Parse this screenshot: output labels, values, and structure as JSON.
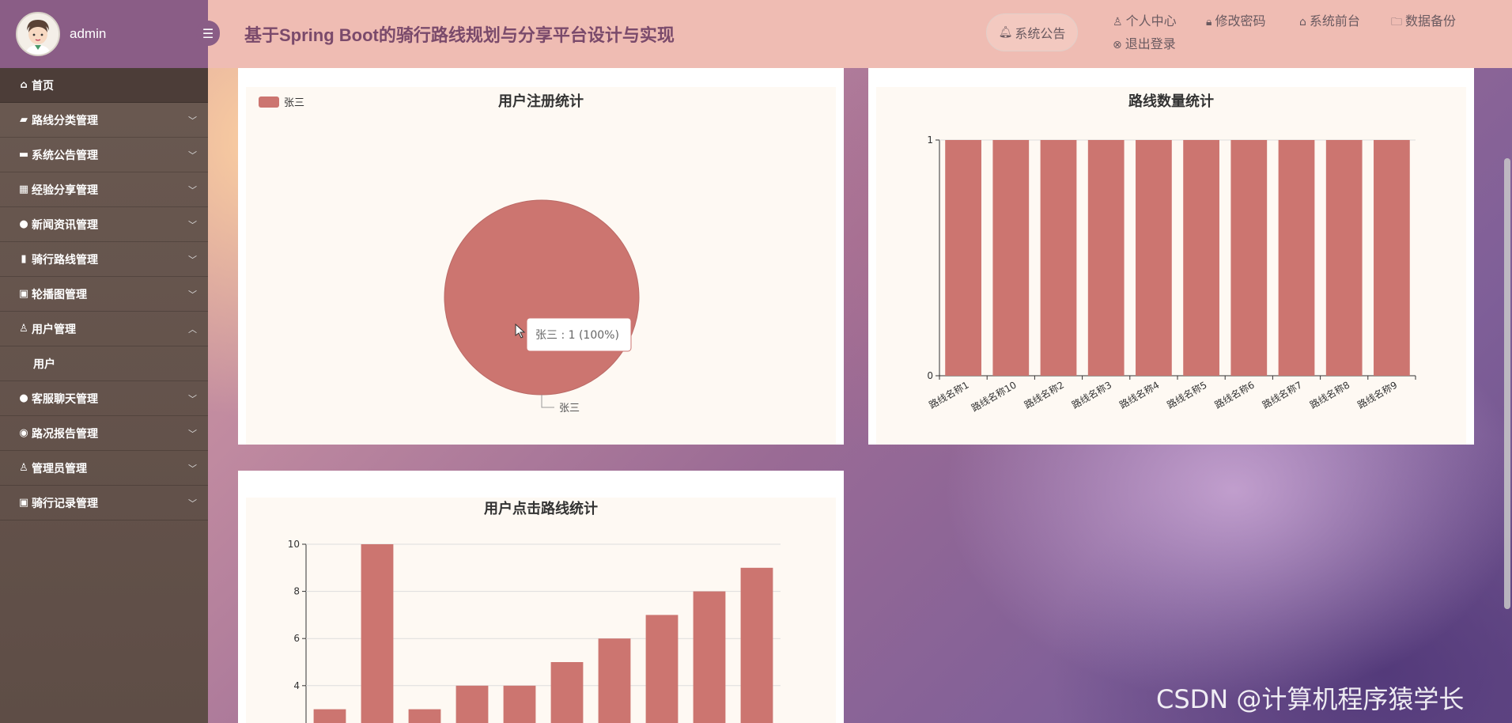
{
  "sidebar": {
    "user": "admin",
    "menu": [
      {
        "label": "首页",
        "icon": "home-icon",
        "chevron": ""
      },
      {
        "label": "路线分类管理",
        "icon": "folder-icon",
        "chevron": "﹀"
      },
      {
        "label": "系统公告管理",
        "icon": "folder-icon",
        "chevron": "﹀"
      },
      {
        "label": "经验分享管理",
        "icon": "grid-icon",
        "chevron": "﹀"
      },
      {
        "label": "新闻资讯管理",
        "icon": "drop-icon",
        "chevron": "﹀"
      },
      {
        "label": "骑行路线管理",
        "icon": "copy-icon",
        "chevron": "﹀"
      },
      {
        "label": "轮播图管理",
        "icon": "book-icon",
        "chevron": "﹀"
      },
      {
        "label": "用户管理",
        "icon": "user-icon",
        "chevron": "︿"
      },
      {
        "label": "客服聊天管理",
        "icon": "circle-icon",
        "chevron": "﹀"
      },
      {
        "label": "路况报告管理",
        "icon": "report-icon",
        "chevron": "﹀"
      },
      {
        "label": "管理员管理",
        "icon": "user-icon",
        "chevron": "﹀"
      },
      {
        "label": "骑行记录管理",
        "icon": "book-icon",
        "chevron": "﹀"
      }
    ],
    "submenu": "用户"
  },
  "header": {
    "title": "基于Spring Boot的骑行路线规划与分享平台设计与实现",
    "notice": "系统公告",
    "links": {
      "profile": "个人中心",
      "password": "修改密码",
      "frontend": "系统前台",
      "backup": "数据备份",
      "logout": "退出登录"
    }
  },
  "chart_data": [
    {
      "type": "pie",
      "title": "用户注册统计",
      "labels": [
        "张三"
      ],
      "values": [
        1
      ],
      "legend": "top-left",
      "tooltip": "张三 : 1 (100%)",
      "color": "#cc7570"
    },
    {
      "type": "bar",
      "title": "路线数量统计",
      "categories": [
        "路线名称1",
        "路线名称10",
        "路线名称2",
        "路线名称3",
        "路线名称4",
        "路线名称5",
        "路线名称6",
        "路线名称7",
        "路线名称8",
        "路线名称9"
      ],
      "values": [
        1,
        1,
        1,
        1,
        1,
        1,
        1,
        1,
        1,
        1
      ],
      "ylim": [
        0,
        1
      ],
      "yticks": [
        0,
        1
      ],
      "color": "#cc7570"
    },
    {
      "type": "bar",
      "title": "用户点击路线统计",
      "values": [
        3,
        10,
        3,
        4,
        4,
        5,
        6,
        7,
        8,
        9
      ],
      "ylim": [
        0,
        10
      ],
      "yticks": [
        4,
        6,
        8,
        10
      ],
      "grid": true,
      "color": "#cc7570"
    }
  ],
  "watermark": "CSDN @计算机程序猿学长"
}
